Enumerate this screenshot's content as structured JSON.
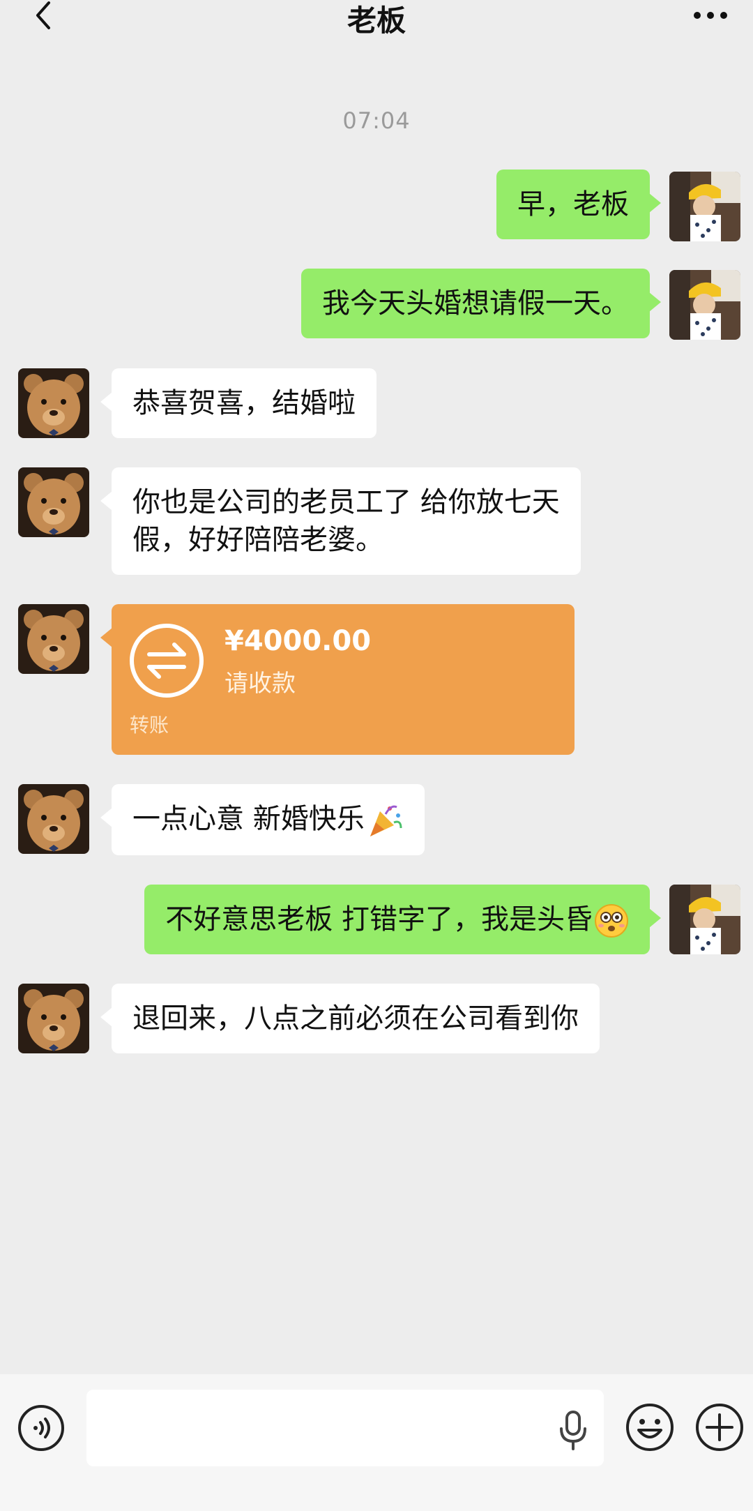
{
  "header": {
    "back_icon": "chevron-left-icon",
    "title": "老板",
    "more_icon": "more-dots-icon"
  },
  "timestamp": "07:04",
  "messages": [
    {
      "sender": "me",
      "text": "早，老板"
    },
    {
      "sender": "me",
      "text": "我今天头婚想请假一天。"
    },
    {
      "sender": "boss",
      "text": "恭喜贺喜，结婚啦"
    },
    {
      "sender": "boss",
      "text_line1": "你也是公司的老员工了 给你放七天",
      "text_line2": "假，好好陪陪老婆。"
    },
    {
      "sender": "boss",
      "type": "transfer",
      "amount": "¥4000.00",
      "status": "请收款",
      "label": "转账",
      "icon": "transfer-arrows-icon"
    },
    {
      "sender": "boss",
      "text": "一点心意 新婚快乐",
      "emoji": "party-popper-icon"
    },
    {
      "sender": "me",
      "text": "不好意思老板 打错字了，我是头昏",
      "emoji": "flushed-face-icon"
    },
    {
      "sender": "boss",
      "text": "退回来，八点之前必须在公司看到你"
    }
  ],
  "avatars": {
    "me": "user-avatar",
    "boss": "teddy-bear-avatar"
  },
  "input_bar": {
    "voice_icon": "voice-icon",
    "input_value": "",
    "mic_icon": "mic-icon",
    "emoji_icon": "smiley-icon",
    "plus_icon": "plus-icon"
  },
  "colors": {
    "background": "#ededed",
    "my_bubble": "#95ec69",
    "their_bubble": "#ffffff",
    "transfer_card": "#f0a04c"
  }
}
